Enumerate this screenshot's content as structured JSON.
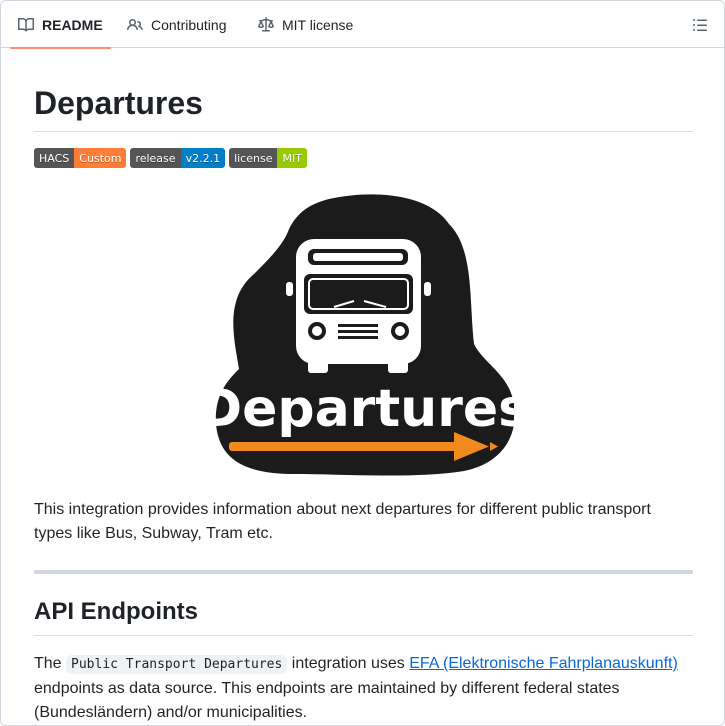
{
  "tabs": [
    {
      "label": "README",
      "icon": "book-icon",
      "active": true
    },
    {
      "label": "Contributing",
      "icon": "people-icon"
    },
    {
      "label": "MIT license",
      "icon": "law-icon"
    }
  ],
  "outline_icon": "list-unordered-icon",
  "readme": {
    "title": "Departures",
    "badges": [
      {
        "left": "HACS",
        "right": "Custom",
        "color": "#fe7d37"
      },
      {
        "left": "release",
        "right": "v2.2.1",
        "color": "#007ec6"
      },
      {
        "left": "license",
        "right": "MIT",
        "color": "#97ca00"
      }
    ],
    "logo_text": "Departures",
    "intro": "This integration provides information about next departures for different public transport types like Bus, Subway, Tram etc.",
    "section_title": "API Endpoints",
    "api_para": {
      "pre": "The ",
      "code": "Public Transport Departures",
      "mid": " integration uses ",
      "link": "EFA (Elektronische Fahrplanauskunft)",
      "post": " endpoints as data source. This endpoints are maintained by different federal states (Bundesländern) and/or municipalities."
    }
  }
}
